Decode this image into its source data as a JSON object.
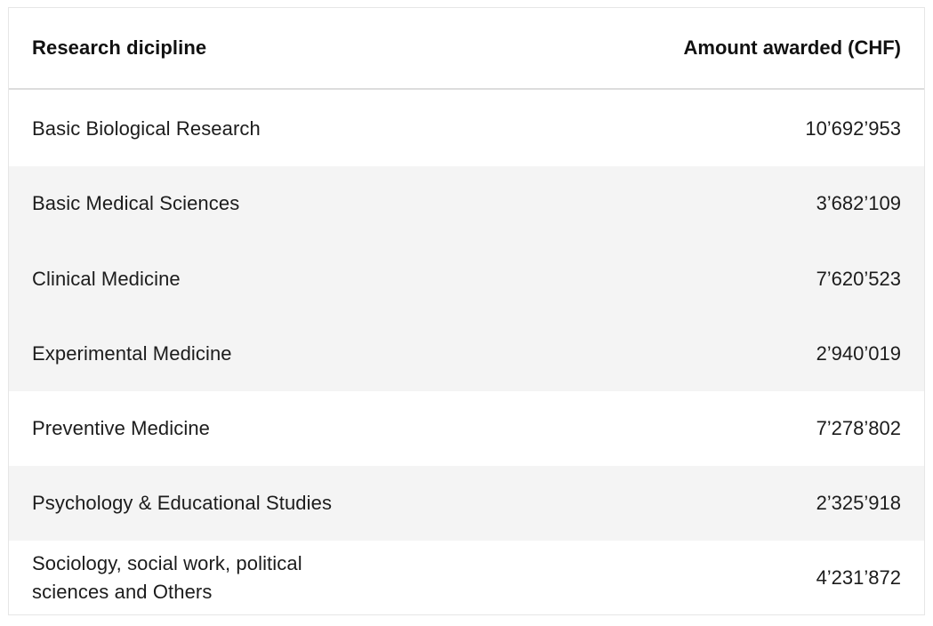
{
  "table": {
    "headers": {
      "discipline": "Research dicipline",
      "amount": "Amount awarded (CHF)"
    },
    "rows": [
      {
        "discipline": "Basic Biological Research",
        "amount": "10’692’953"
      },
      {
        "discipline": "Basic Medical Sciences",
        "amount": "3’682’109"
      },
      {
        "discipline": "Clinical Medicine",
        "amount": "7’620’523"
      },
      {
        "discipline": "Experimental Medicine",
        "amount": "2’940’019"
      },
      {
        "discipline": "Preventive Medicine",
        "amount": "7’278’802"
      },
      {
        "discipline": "Psychology & Educational Studies",
        "amount": "2’325’918"
      },
      {
        "discipline": "Sociology, social work, political sciences and Others",
        "amount": "4’231’872"
      }
    ]
  },
  "colors": {
    "shaded_row": "#f4f4f4",
    "text": "#1c1c1c",
    "border": "#dcdcdc"
  }
}
